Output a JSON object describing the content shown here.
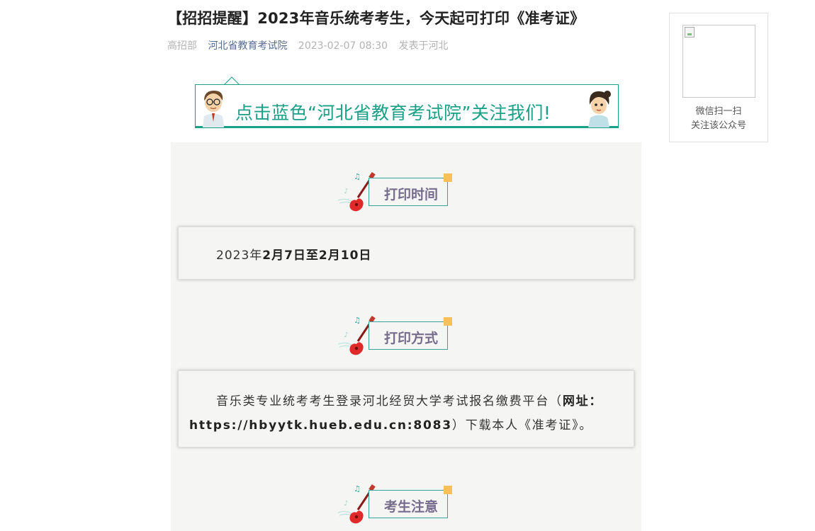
{
  "article": {
    "title": "【招招提醒】2023年音乐统考考生，今天起可打印《准考证》",
    "author": "高招部",
    "account": "河北省教育考试院",
    "datetime": "2023-02-07 08:30",
    "location": "发表于河北"
  },
  "sidebar": {
    "qr_line1": "微信扫一扫",
    "qr_line2": "关注该公众号"
  },
  "banner": {
    "text": "点击蓝色“河北省教育考试院”关注我们!"
  },
  "sections": [
    {
      "heading": "打印时间",
      "body": {
        "prefix": "2023年",
        "bold": "2月7日至2月10日"
      }
    },
    {
      "heading": "打印方式",
      "body": {
        "text1": "音乐类专业统考考生登录河北经贸大学考试报名缴费平台（",
        "bold1": "网址：",
        "bold2": "https://hbyytk.hueb.edu.cn:8083",
        "text2": "）下载本人《准考证》。"
      }
    },
    {
      "heading": "考生注意"
    }
  ],
  "colors": {
    "banner_green": "#1aa086",
    "section_label": "#766c8e",
    "content_bg": "#f5f5f3",
    "accent_square": "#f7c15a",
    "link_blue": "#576b95"
  },
  "icons": [
    "guitar-icon",
    "music-note-icon",
    "boy-avatar-icon",
    "girl-avatar-icon",
    "broken-image-icon"
  ]
}
